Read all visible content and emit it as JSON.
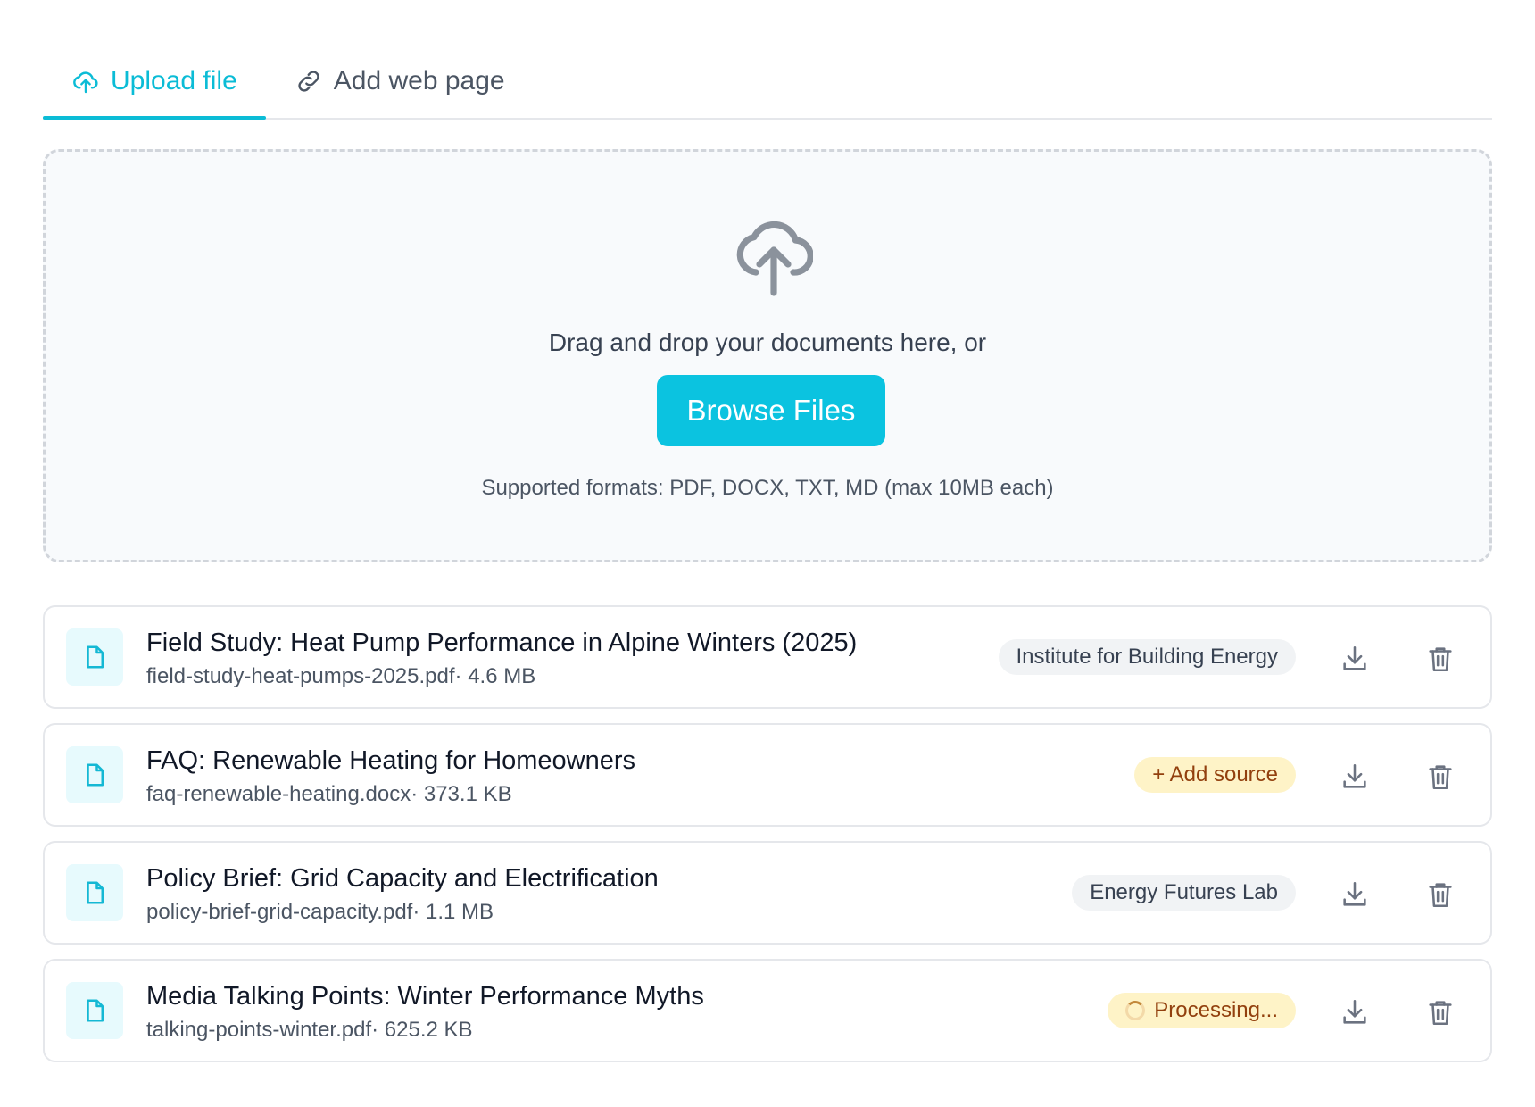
{
  "tabs": [
    {
      "label": "Upload file",
      "icon": "cloud-upload-icon",
      "active": true
    },
    {
      "label": "Add web page",
      "icon": "link-icon",
      "active": false
    }
  ],
  "dropzone": {
    "icon": "cloud-upload-icon",
    "prompt": "Drag and drop your documents here, or",
    "browse_label": "Browse Files",
    "formats": "Supported formats: PDF, DOCX, TXT, MD (max 10MB each)"
  },
  "files": [
    {
      "title": "Field Study: Heat Pump Performance in Alpine Winters (2025)",
      "meta": "field-study-heat-pumps-2025.pdf· 4.6 MB",
      "badge": "Institute for Building Energy",
      "badge_type": "source"
    },
    {
      "title": "FAQ: Renewable Heating for Homeowners",
      "meta": "faq-renewable-heating.docx· 373.1 KB",
      "badge": "+ Add source",
      "badge_type": "add"
    },
    {
      "title": "Policy Brief: Grid Capacity and Electrification",
      "meta": "policy-brief-grid-capacity.pdf· 1.1 MB",
      "badge": "Energy Futures Lab",
      "badge_type": "source"
    },
    {
      "title": "Media Talking Points: Winter Performance Myths",
      "meta": "talking-points-winter.pdf· 625.2 KB",
      "badge": "Processing...",
      "badge_type": "processing"
    }
  ],
  "colors": {
    "accent": "#0bc3e0",
    "tab_active": "#0bbcd6",
    "warning_bg": "#fef3c7",
    "warning_text": "#92400e"
  }
}
